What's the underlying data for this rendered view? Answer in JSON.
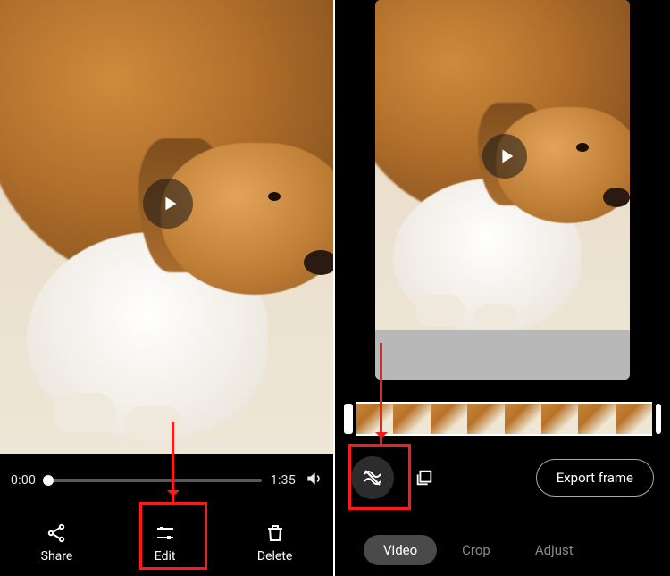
{
  "left": {
    "currentTime": "0:00",
    "duration": "1:35",
    "actions": {
      "share": "Share",
      "edit": "Edit",
      "delete": "Delete"
    }
  },
  "right": {
    "exportFrame": "Export frame",
    "tabs": {
      "video": "Video",
      "crop": "Crop",
      "adjust": "Adjust"
    }
  },
  "icons": {
    "play": "play-icon",
    "volume": "volume-icon",
    "share": "share-icon",
    "edit": "tune-icon",
    "delete": "trash-icon",
    "stabilize": "stabilize-icon",
    "frameExport": "frame-export-icon"
  },
  "colors": {
    "annotation": "#ff1a1a",
    "activeTabBg": "#4a4a4a"
  }
}
